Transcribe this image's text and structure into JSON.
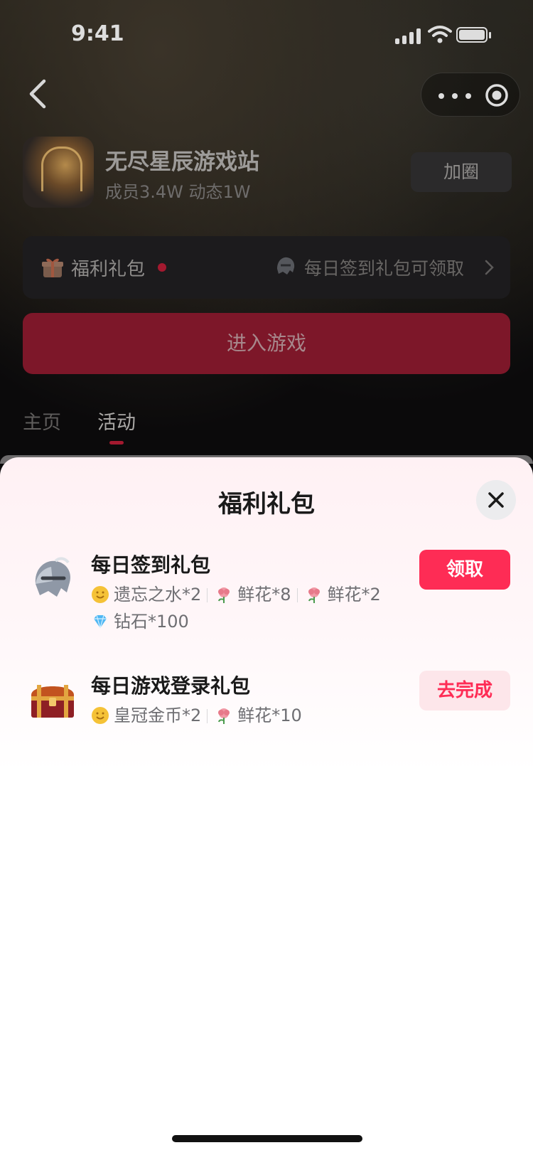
{
  "status_bar": {
    "time": "9:41"
  },
  "group": {
    "name": "无尽星辰游戏站",
    "meta": "成员3.4W 动态1W",
    "join_label": "加圈"
  },
  "welfare_bar": {
    "label": "福利礼包",
    "checkin_text": "每日签到礼包可领取"
  },
  "enter_game_label": "进入游戏",
  "tabs": [
    {
      "label": "主页",
      "active": false
    },
    {
      "label": "活动",
      "active": true
    }
  ],
  "sheet": {
    "title": "福利礼包",
    "gifts": [
      {
        "name": "每日签到礼包",
        "icon": "helmet-icon",
        "button": "领取",
        "rewards": [
          {
            "icon": "smiley-coin-icon",
            "text": "遗忘之水*2"
          },
          {
            "icon": "flower-icon",
            "text": "鲜花*8"
          },
          {
            "icon": "flower-icon",
            "text": "鲜花*2"
          },
          {
            "icon": "diamond-icon",
            "text": "钻石*100"
          }
        ]
      },
      {
        "name": "每日游戏登录礼包",
        "icon": "treasure-chest-icon",
        "button": "去完成",
        "rewards": [
          {
            "icon": "smiley-coin-icon",
            "text": "皇冠金币*2"
          },
          {
            "icon": "flower-icon",
            "text": "鲜花*10"
          }
        ]
      }
    ]
  },
  "colors": {
    "accent": "#fe2c55",
    "enter_button_dimmed": "#7d1729",
    "sheet_bg_top": "#fff1f4"
  }
}
